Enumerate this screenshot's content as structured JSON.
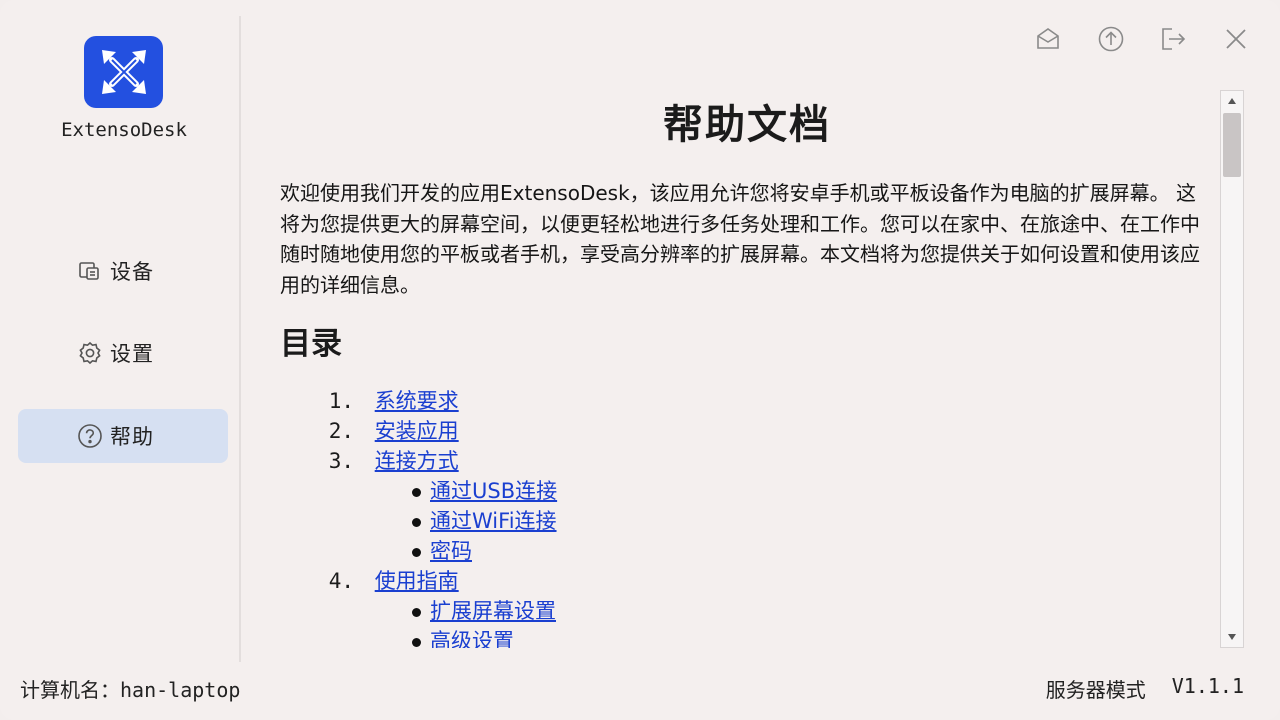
{
  "app": {
    "name": "ExtensoDesk",
    "accent": "#2350e0",
    "logo_icon": "x-arrows-logo-icon"
  },
  "window_controls": [
    {
      "name": "mail-icon"
    },
    {
      "name": "upload-icon"
    },
    {
      "name": "logout-icon"
    },
    {
      "name": "close-icon"
    }
  ],
  "sidebar": {
    "items": [
      {
        "label": "设备",
        "icon": "devices-icon",
        "active": false
      },
      {
        "label": "设置",
        "icon": "gear-icon",
        "active": false
      },
      {
        "label": "帮助",
        "icon": "help-circle-icon",
        "active": true
      }
    ]
  },
  "doc": {
    "title": "帮助文档",
    "intro": "欢迎使用我们开发的应用ExtensoDesk，该应用允许您将安卓手机或平板设备作为电脑的扩展屏幕。 这将为您提供更大的屏幕空间，以便更轻松地进行多任务处理和工作。您可以在家中、在旅途中、在工作中随时随地使用您的平板或者手机，享受高分辨率的扩展屏幕。本文档将为您提供关于如何设置和使用该应用的详细信息。",
    "toc_title": "目录",
    "toc": [
      {
        "num": "1.",
        "label": "系统要求",
        "children": []
      },
      {
        "num": "2.",
        "label": "安装应用",
        "children": []
      },
      {
        "num": "3.",
        "label": "连接方式",
        "children": [
          "通过USB连接",
          "通过WiFi连接",
          "密码"
        ]
      },
      {
        "num": "4.",
        "label": "使用指南",
        "children": [
          "扩展屏幕设置",
          "高级设置"
        ]
      }
    ]
  },
  "footer": {
    "computer_label": "计算机名：",
    "computer_name": "han-laptop",
    "mode": "服务器模式",
    "version": "V1.1.1"
  }
}
